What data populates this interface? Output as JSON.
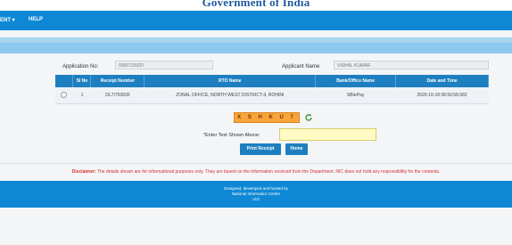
{
  "header": {
    "title": "Government of India"
  },
  "nav": {
    "items": [
      "ENT ▾",
      "HELP"
    ]
  },
  "form": {
    "application_no_label": "Application No:",
    "application_no_value": "0000733920",
    "applicant_name_label": "Applicant Name",
    "applicant_name_value": "VISHAL KUMAR"
  },
  "table": {
    "headers": [
      "Sl No",
      "Receipt Number",
      "RTO Name",
      "Bank/Office Name",
      "Date and Time"
    ],
    "rows": [
      [
        "1",
        "DL7/753930",
        "ZONAL OFFICE, NORTH WEST DISTRICT-II, ROHINI",
        "SBIePay",
        "2020-10-18 08:50:58.582"
      ]
    ]
  },
  "captcha": {
    "text": "X S H K U 7",
    "label": "*Enter Text Shown Above:",
    "input_value": ""
  },
  "buttons": {
    "print": "Print Receipt",
    "home": "Home"
  },
  "disclaimer": {
    "label": "Disclaimer:",
    "text": "The details shown are for informational purposes only. They are based on the information received from the Department. NIC does not hold any responsibility for the contents."
  },
  "footer": {
    "line1": "Designed, developed and hosted by",
    "line2": "National Informatics Centre",
    "line3": "v13"
  },
  "colors": {
    "nav_blue": "#0e88d4",
    "table_header": "#1e7fc0",
    "captcha_bg": "#f7a538",
    "disclaimer_red": "#d63030"
  }
}
